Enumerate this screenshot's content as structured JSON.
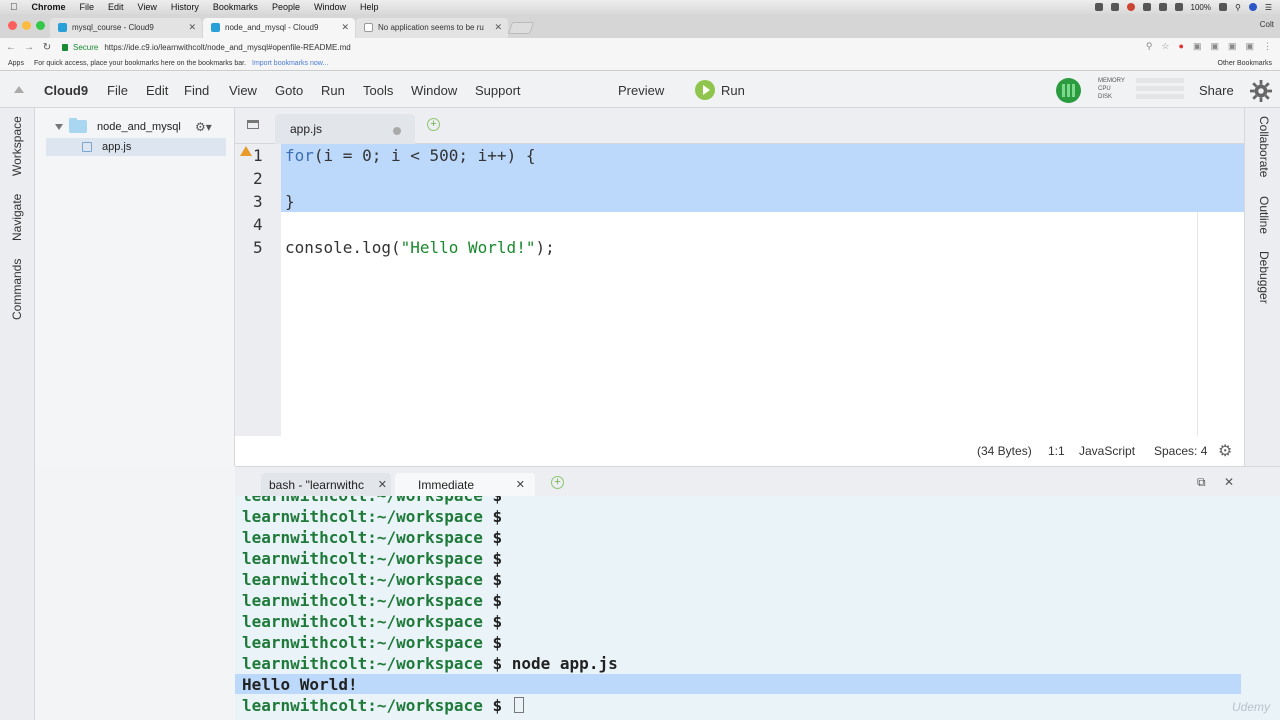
{
  "mac": {
    "menu": [
      "Chrome",
      "File",
      "Edit",
      "View",
      "History",
      "Bookmarks",
      "People",
      "Window",
      "Help"
    ],
    "battery": "100%",
    "user": "Colt"
  },
  "browser": {
    "tabs": [
      {
        "label": "mysql_course - Cloud9"
      },
      {
        "label": "node_and_mysql - Cloud9"
      },
      {
        "label": "No application seems to be ru"
      }
    ],
    "secure_label": "Secure",
    "url": "https://ide.c9.io/learnwithcolt/node_and_mysql#openfile-README.md",
    "bookmarks": {
      "apps": "Apps",
      "hint": "For quick access, place your bookmarks here on the bookmarks bar.",
      "import": "Import bookmarks now...",
      "other": "Other Bookmarks"
    }
  },
  "c9": {
    "brand": "Cloud9",
    "menu": [
      "File",
      "Edit",
      "Find",
      "View",
      "Goto",
      "Run",
      "Tools",
      "Window",
      "Support"
    ],
    "preview": "Preview",
    "run": "Run",
    "share": "Share",
    "usage": [
      "MEMORY",
      "CPU",
      "DISK"
    ],
    "left_panels": [
      "Workspace",
      "Navigate",
      "Commands"
    ],
    "right_panels": [
      "Collaborate",
      "Outline",
      "Debugger"
    ]
  },
  "tree": {
    "folder": "node_and_mysql",
    "file": "app.js"
  },
  "editor": {
    "tab": "app.js",
    "line_numbers": [
      "1",
      "2",
      "3",
      "4",
      "5"
    ],
    "lines": {
      "l1_kw": "for",
      "l1_rest": "(i = 0; i < 500; i++) {",
      "l3": "}",
      "l5_a": "console.log(",
      "l5_str": "\"Hello World!\"",
      "l5_b": ");"
    },
    "status": {
      "bytes": "(34 Bytes)",
      "pos": "1:1",
      "lang": "JavaScript",
      "spaces": "Spaces: 4"
    }
  },
  "terminal": {
    "tabs": [
      "bash - \"learnwithc",
      "Immediate"
    ],
    "prompt": "learnwithcolt:~/workspace",
    "dollar": "$",
    "command": "node app.js",
    "output": "Hello World!"
  },
  "watermark": "Udemy"
}
